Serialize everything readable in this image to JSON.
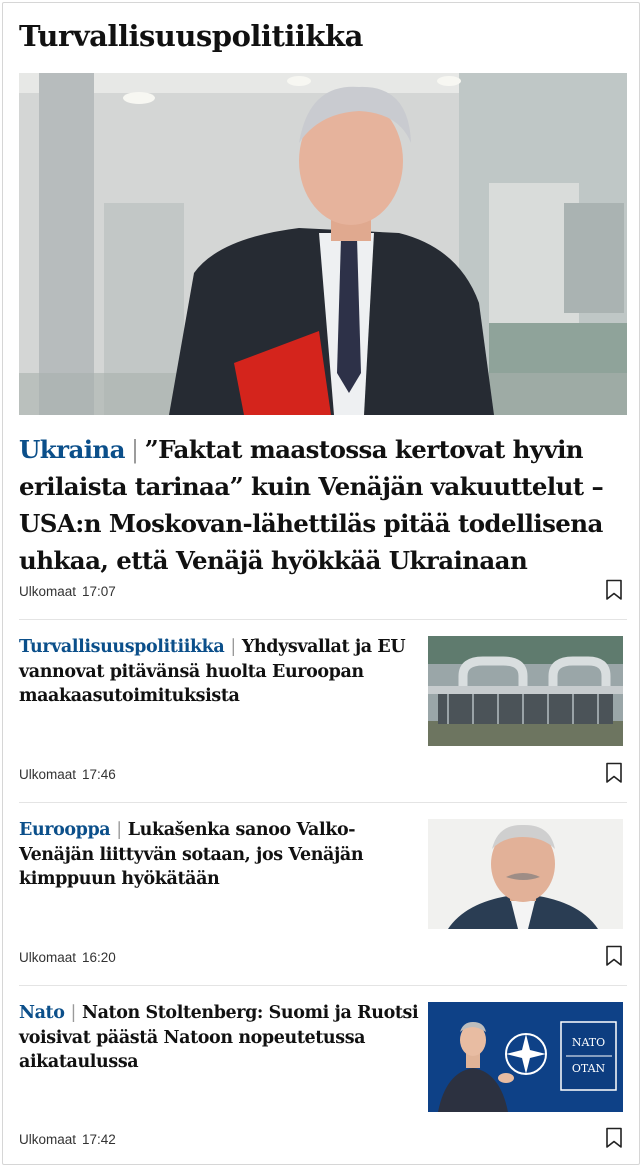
{
  "section": {
    "title": "Turvallisuuspolitiikka"
  },
  "hero": {
    "kicker": "Ukraina",
    "headline": "”Faktat maastossa kertovat hyvin erilaista tarinaa” kuin Venäjän vakuuttelut – USA:n Moskovan-lähettiläs pitää todellisena uhkaa, että Venäjä hyökkää Ukrainaan",
    "category": "Ulkomaat",
    "time": "17:07"
  },
  "articles": [
    {
      "kicker": "Turvallisuuspolitiikka",
      "headline": "Yhdysvallat ja EU vannovat pitävänsä huolta Euroopan maakaasutoimituksista",
      "category": "Ulkomaat",
      "time": "17:46"
    },
    {
      "kicker": "Eurooppa",
      "headline": "Lukašenka sanoo Valko-Venäjän liittyvän sotaan, jos Venäjän kimppuun hyökätään",
      "category": "Ulkomaat",
      "time": "16:20"
    },
    {
      "kicker": "Nato",
      "headline": "Naton Stoltenberg: Suomi ja Ruotsi voisivat päästä Natoon nopeutetussa aikataulussa",
      "category": "Ulkomaat",
      "time": "17:42"
    }
  ],
  "images": {
    "nato_sign": "NATO OTAN"
  },
  "colors": {
    "kicker": "#0b4f8a",
    "text": "#111111",
    "meta": "#333333"
  }
}
